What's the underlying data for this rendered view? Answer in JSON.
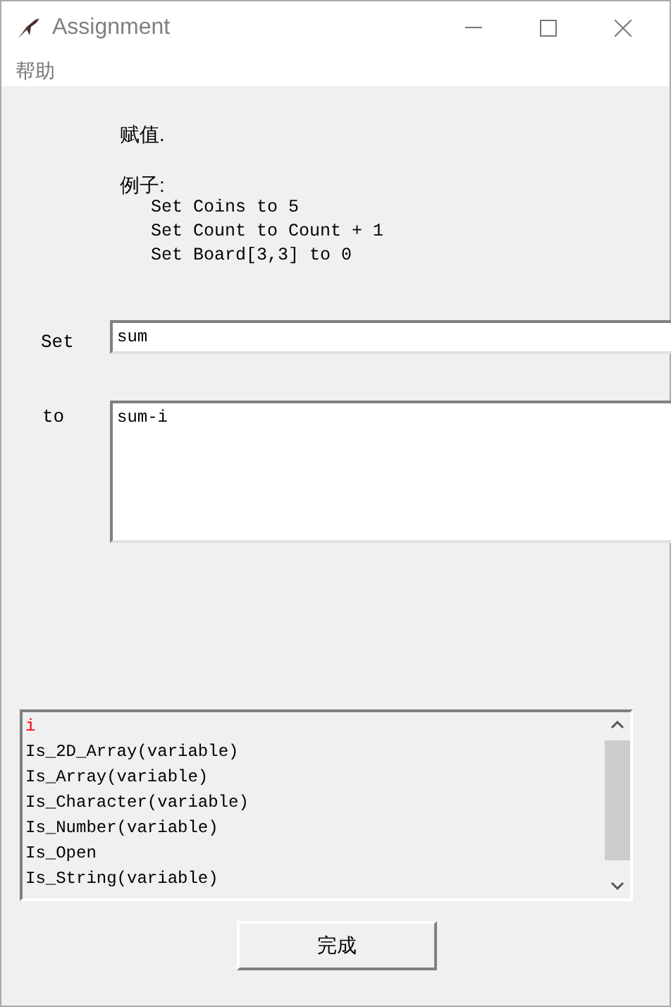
{
  "window": {
    "title": "Assignment"
  },
  "menu": [
    "帮助"
  ],
  "description": "赋值.",
  "examples_heading": "例子:",
  "examples": [
    "Set Coins to 5",
    "Set Count to Count + 1",
    "Set Board[3,3] to 0"
  ],
  "set_field": {
    "label": "Set",
    "value": "sum"
  },
  "to_field": {
    "label": "to",
    "value": "sum-i"
  },
  "list": [
    {
      "text": "i",
      "color": "#ff0000"
    },
    {
      "text": "Is_2D_Array(variable)",
      "color": "#000000"
    },
    {
      "text": "Is_Array(variable)",
      "color": "#000000"
    },
    {
      "text": "Is_Character(variable)",
      "color": "#000000"
    },
    {
      "text": "Is_Number(variable)",
      "color": "#000000"
    },
    {
      "text": "Is_Open",
      "color": "#000000"
    },
    {
      "text": "Is_String(variable)",
      "color": "#000000"
    }
  ],
  "done_button": "完成"
}
